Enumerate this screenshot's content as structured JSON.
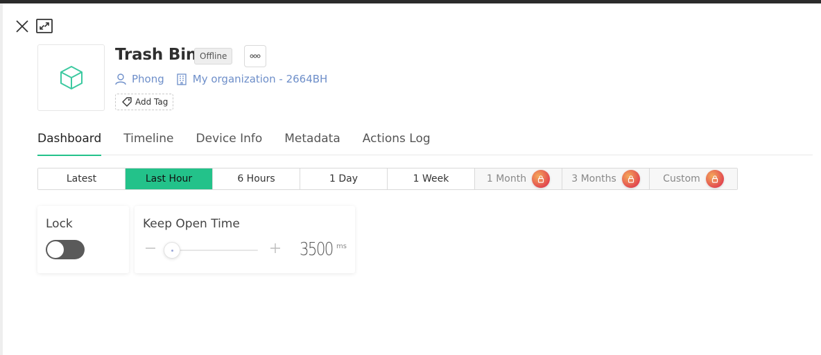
{
  "header": {
    "title": "Trash Bin",
    "status": "Offline",
    "owner": "Phong",
    "organization": "My organization - 2664BH",
    "add_tag_label": "Add Tag"
  },
  "tabs": [
    {
      "label": "Dashboard",
      "active": true
    },
    {
      "label": "Timeline"
    },
    {
      "label": "Device Info"
    },
    {
      "label": "Metadata"
    },
    {
      "label": "Actions Log"
    }
  ],
  "time_ranges": [
    {
      "label": "Latest"
    },
    {
      "label": "Last Hour",
      "active": true
    },
    {
      "label": "6 Hours"
    },
    {
      "label": "1 Day"
    },
    {
      "label": "1 Week"
    },
    {
      "label": "1 Month",
      "locked": true
    },
    {
      "label": "3 Months",
      "locked": true
    },
    {
      "label": "Custom",
      "locked": true
    }
  ],
  "widgets": {
    "lock": {
      "title": "Lock",
      "state": "off"
    },
    "keep_open": {
      "title": "Keep Open Time",
      "value": "3500",
      "unit": "ms",
      "level": 0.05
    }
  },
  "colors": {
    "accent": "#23c28a",
    "link": "#6d8ec9",
    "device_icon": "#3cc9a0"
  },
  "icons": {
    "close": "close-icon",
    "expand": "expand-icon",
    "device": "cube-icon",
    "more": "more-icon",
    "user": "user-icon",
    "org": "building-icon",
    "tag": "tag-icon",
    "lock": "lock-icon"
  }
}
